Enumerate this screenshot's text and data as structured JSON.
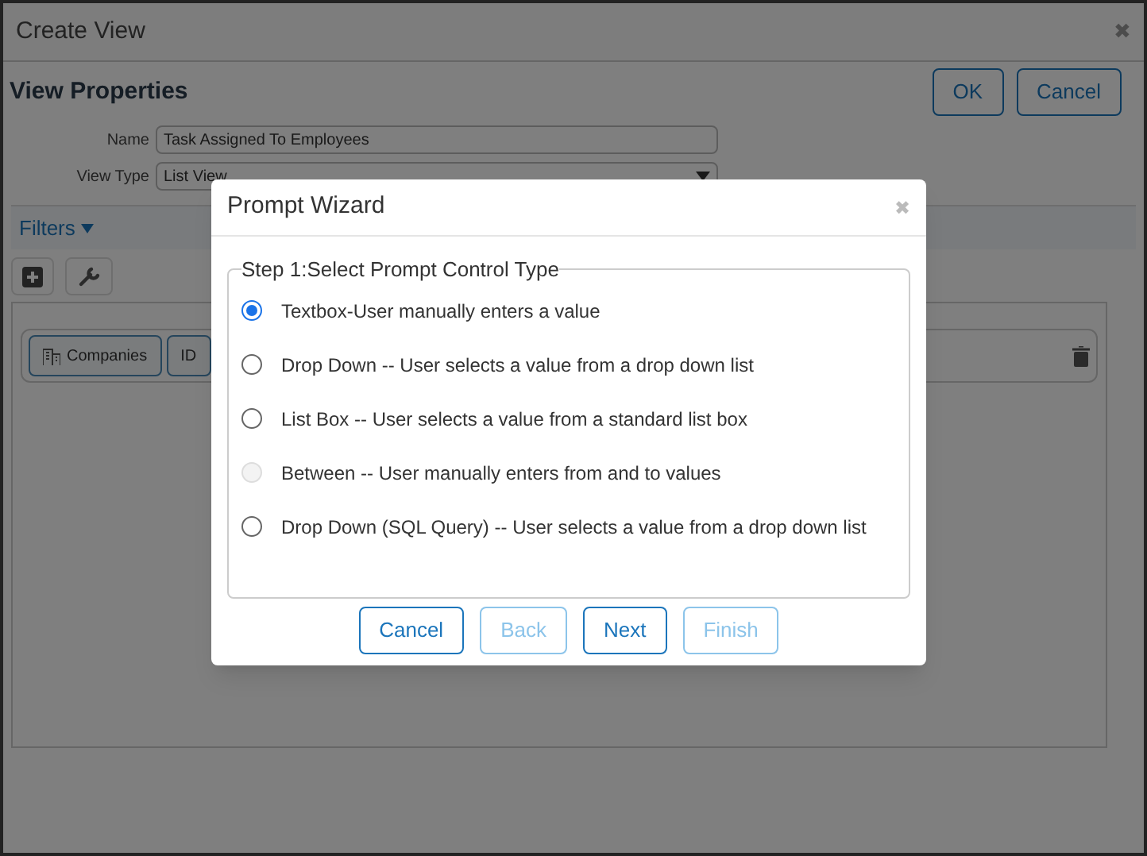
{
  "window": {
    "title": "Create View",
    "close": "✖"
  },
  "header": {
    "title": "View Properties",
    "buttons": [
      {
        "label": "OK"
      },
      {
        "label": "Cancel"
      }
    ]
  },
  "form": {
    "fields": [
      {
        "label": "Name",
        "value": "Task Assigned To Employees",
        "kind": "text"
      },
      {
        "label": "View Type",
        "value": "List View",
        "kind": "select"
      }
    ]
  },
  "filters": {
    "label": "Filters",
    "expanded": true,
    "chips": [
      {
        "label": "Companies",
        "icon": true
      },
      {
        "label": "ID",
        "icon": false
      }
    ]
  },
  "dialog": {
    "title": "Prompt Wizard",
    "close": "✖",
    "legend": "Step 1:Select Prompt Control Type",
    "options": [
      {
        "label": "Textbox-User manually enters a value",
        "selected": true,
        "disabled": false
      },
      {
        "label": "Drop Down -- User selects a value from a drop down list",
        "selected": false,
        "disabled": false
      },
      {
        "label": "List Box -- User selects a value from a standard list box",
        "selected": false,
        "disabled": false
      },
      {
        "label": "Between -- User manually enters from and to values",
        "selected": false,
        "disabled": true
      },
      {
        "label": "Drop Down (SQL Query) -- User selects a value from a drop down list",
        "selected": false,
        "disabled": false
      }
    ],
    "buttons": [
      {
        "label": "Cancel",
        "disabled": false
      },
      {
        "label": "Back",
        "disabled": true
      },
      {
        "label": "Next",
        "disabled": false
      },
      {
        "label": "Finish",
        "disabled": true
      }
    ]
  }
}
